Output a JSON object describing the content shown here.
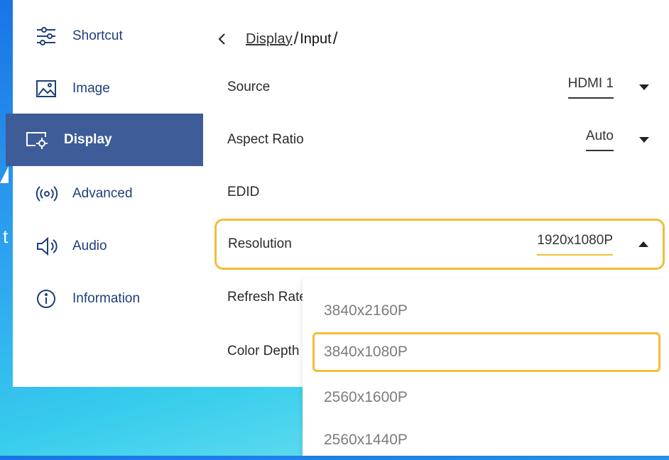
{
  "sidebar": {
    "items": [
      {
        "label": "Shortcut",
        "icon": "sliders-icon"
      },
      {
        "label": "Image",
        "icon": "image-icon"
      },
      {
        "label": "Display",
        "icon": "display-settings-icon",
        "active": true
      },
      {
        "label": "Advanced",
        "icon": "broadcast-icon"
      },
      {
        "label": "Audio",
        "icon": "speaker-icon"
      },
      {
        "label": "Information",
        "icon": "info-icon"
      }
    ]
  },
  "breadcrumb": {
    "parent": "Display",
    "separator": "/",
    "current": "Input"
  },
  "settings": {
    "source": {
      "label": "Source",
      "value": "HDMI 1"
    },
    "aspect_ratio": {
      "label": "Aspect Ratio",
      "value": "Auto"
    },
    "edid": {
      "label": "EDID"
    },
    "resolution": {
      "label": "Resolution",
      "value": "1920x1080P"
    },
    "refresh_rate": {
      "label": "Refresh Rate"
    },
    "color_depth": {
      "label": "Color Depth"
    }
  },
  "dropdown": {
    "options": [
      "3840x2160P",
      "3840x1080P",
      "2560x1600P",
      "2560x1440P"
    ],
    "highlighted_index": 1
  },
  "wallpaper": {
    "text": "t"
  },
  "colors": {
    "accent_active": "#3d5c98",
    "focus_outline": "#f2bd3a",
    "sidebar_text": "#1e3f7a"
  }
}
